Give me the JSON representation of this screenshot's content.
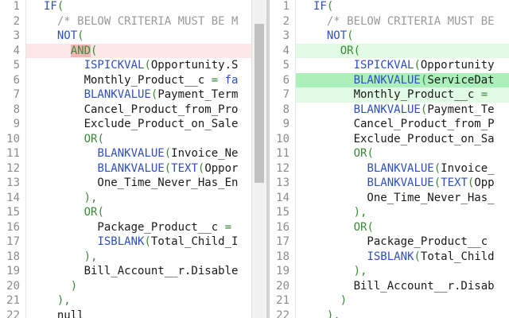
{
  "line_numbers": [
    "1",
    "2",
    "3",
    "4",
    "5",
    "6",
    "7",
    "8",
    "9",
    "10",
    "11",
    "12",
    "13",
    "14",
    "15",
    "16",
    "17",
    "18",
    "19",
    "20",
    "21",
    "22"
  ],
  "left_pane": {
    "lines": [
      [
        {
          "c": "t-fn",
          "t": "IF"
        },
        {
          "c": "t-par",
          "t": "("
        }
      ],
      [
        {
          "c": "t-cm",
          "t": "  /* BELOW CRITERIA MUST BE M"
        }
      ],
      [
        {
          "c": "t-fn",
          "t": "  NOT"
        },
        {
          "c": "t-par",
          "t": "("
        }
      ],
      [
        {
          "c": "t-id",
          "t": "    "
        },
        {
          "c": "t-op hl-del",
          "t": "AND"
        },
        {
          "c": "t-par",
          "t": "("
        }
      ],
      [
        {
          "c": "t-id",
          "t": "      "
        },
        {
          "c": "t-fn",
          "t": "ISPICKVAL"
        },
        {
          "c": "t-par",
          "t": "("
        },
        {
          "c": "t-id",
          "t": "Opportunity.S"
        }
      ],
      [
        {
          "c": "t-id",
          "t": "      Monthly_Product__c "
        },
        {
          "c": "t-op",
          "t": "="
        },
        {
          "c": "t-kw",
          "t": " fa"
        }
      ],
      [
        {
          "c": "t-id",
          "t": "      "
        },
        {
          "c": "t-fn",
          "t": "BLANKVALUE"
        },
        {
          "c": "t-par",
          "t": "("
        },
        {
          "c": "t-id",
          "t": "Payment_Term"
        }
      ],
      [
        {
          "c": "t-id",
          "t": "      Cancel_Product_from_Pro"
        }
      ],
      [
        {
          "c": "t-id",
          "t": "      Exclude_Product_on_Sale"
        }
      ],
      [
        {
          "c": "t-id",
          "t": "      "
        },
        {
          "c": "t-op",
          "t": "OR"
        },
        {
          "c": "t-par",
          "t": "("
        }
      ],
      [
        {
          "c": "t-id",
          "t": "        "
        },
        {
          "c": "t-fn",
          "t": "BLANKVALUE"
        },
        {
          "c": "t-par",
          "t": "("
        },
        {
          "c": "t-id",
          "t": "Invoice_Ne"
        }
      ],
      [
        {
          "c": "t-id",
          "t": "        "
        },
        {
          "c": "t-fn",
          "t": "BLANKVALUE"
        },
        {
          "c": "t-par",
          "t": "("
        },
        {
          "c": "t-fn",
          "t": "TEXT"
        },
        {
          "c": "t-par",
          "t": "("
        },
        {
          "c": "t-id",
          "t": "Oppor"
        }
      ],
      [
        {
          "c": "t-id",
          "t": "        One_Time_Never_Has_En"
        }
      ],
      [
        {
          "c": "t-par",
          "t": "      ),"
        }
      ],
      [
        {
          "c": "t-id",
          "t": "      "
        },
        {
          "c": "t-op",
          "t": "OR"
        },
        {
          "c": "t-par",
          "t": "("
        }
      ],
      [
        {
          "c": "t-id",
          "t": "        Package_Product__c "
        },
        {
          "c": "t-op",
          "t": "="
        }
      ],
      [
        {
          "c": "t-id",
          "t": "        "
        },
        {
          "c": "t-fn",
          "t": "ISBLANK"
        },
        {
          "c": "t-par",
          "t": "("
        },
        {
          "c": "t-id",
          "t": "Total_Child_I"
        }
      ],
      [
        {
          "c": "t-par",
          "t": "      ),"
        }
      ],
      [
        {
          "c": "t-id",
          "t": "      Bill_Account__r.Disable"
        }
      ],
      [
        {
          "c": "t-par",
          "t": "    )"
        }
      ],
      [
        {
          "c": "t-par",
          "t": "  ),"
        }
      ],
      [
        {
          "c": "t-id",
          "t": "  null"
        }
      ]
    ],
    "row_state": [
      "",
      "",
      "",
      "del",
      "",
      "",
      "",
      "",
      "",
      "",
      "",
      "",
      "",
      "",
      "",
      "",
      "",
      "",
      "",
      "",
      "",
      ""
    ]
  },
  "right_pane": {
    "lines": [
      [
        {
          "c": "t-fn",
          "t": "IF"
        },
        {
          "c": "t-par",
          "t": "("
        }
      ],
      [
        {
          "c": "t-cm",
          "t": "  /* BELOW CRITERIA MUST BE"
        }
      ],
      [
        {
          "c": "t-fn",
          "t": "  NOT"
        },
        {
          "c": "t-par",
          "t": "("
        }
      ],
      [
        {
          "c": "t-id",
          "t": "    "
        },
        {
          "c": "t-op",
          "t": "OR"
        },
        {
          "c": "t-par",
          "t": "("
        }
      ],
      [
        {
          "c": "t-id",
          "t": "      "
        },
        {
          "c": "t-fn",
          "t": "ISPICKVAL"
        },
        {
          "c": "t-par",
          "t": "("
        },
        {
          "c": "t-id",
          "t": "Opportunity"
        }
      ],
      [
        {
          "c": "t-id",
          "t": "      "
        },
        {
          "c": "t-fn",
          "t": "BLANKVALUE"
        },
        {
          "c": "t-par",
          "t": "("
        },
        {
          "c": "t-id",
          "t": "ServiceDat"
        }
      ],
      [
        {
          "c": "t-id",
          "t": "      Monthly_Product__c "
        },
        {
          "c": "t-op",
          "t": "="
        }
      ],
      [
        {
          "c": "t-id",
          "t": "      "
        },
        {
          "c": "t-fn",
          "t": "BLANKVALUE"
        },
        {
          "c": "t-par",
          "t": "("
        },
        {
          "c": "t-id",
          "t": "Payment_Te"
        }
      ],
      [
        {
          "c": "t-id",
          "t": "      Cancel_Product_from_P"
        }
      ],
      [
        {
          "c": "t-id",
          "t": "      Exclude_Product_on_Sa"
        }
      ],
      [
        {
          "c": "t-id",
          "t": "      "
        },
        {
          "c": "t-op",
          "t": "OR"
        },
        {
          "c": "t-par",
          "t": "("
        }
      ],
      [
        {
          "c": "t-id",
          "t": "        "
        },
        {
          "c": "t-fn",
          "t": "BLANKVALUE"
        },
        {
          "c": "t-par",
          "t": "("
        },
        {
          "c": "t-id",
          "t": "Invoice_"
        }
      ],
      [
        {
          "c": "t-id",
          "t": "        "
        },
        {
          "c": "t-fn",
          "t": "BLANKVALUE"
        },
        {
          "c": "t-par",
          "t": "("
        },
        {
          "c": "t-fn",
          "t": "TEXT"
        },
        {
          "c": "t-par",
          "t": "("
        },
        {
          "c": "t-id",
          "t": "Opp"
        }
      ],
      [
        {
          "c": "t-id",
          "t": "        One_Time_Never_Has_"
        }
      ],
      [
        {
          "c": "t-par",
          "t": "      ),"
        }
      ],
      [
        {
          "c": "t-id",
          "t": "      "
        },
        {
          "c": "t-op",
          "t": "OR"
        },
        {
          "c": "t-par",
          "t": "("
        }
      ],
      [
        {
          "c": "t-id",
          "t": "        Package_Product__c"
        }
      ],
      [
        {
          "c": "t-id",
          "t": "        "
        },
        {
          "c": "t-fn",
          "t": "ISBLANK"
        },
        {
          "c": "t-par",
          "t": "("
        },
        {
          "c": "t-id",
          "t": "Total_Child"
        }
      ],
      [
        {
          "c": "t-par",
          "t": "      ),"
        }
      ],
      [
        {
          "c": "t-id",
          "t": "      Bill_Account__r.Disab"
        }
      ],
      [
        {
          "c": "t-par",
          "t": "    )"
        }
      ],
      [
        {
          "c": "t-par",
          "t": "  ),"
        }
      ]
    ],
    "row_state": [
      "",
      "",
      "",
      "add",
      "",
      "add-strong",
      "add",
      "",
      "",
      "",
      "",
      "",
      "",
      "",
      "",
      "",
      "",
      "",
      "",
      "",
      "",
      ""
    ]
  },
  "colors": {
    "deleted_line": "#fde6e6",
    "deleted_token": "#f7b6b6",
    "added_line": "#e2fbe5",
    "added_line_strong": "#abf0ba"
  }
}
